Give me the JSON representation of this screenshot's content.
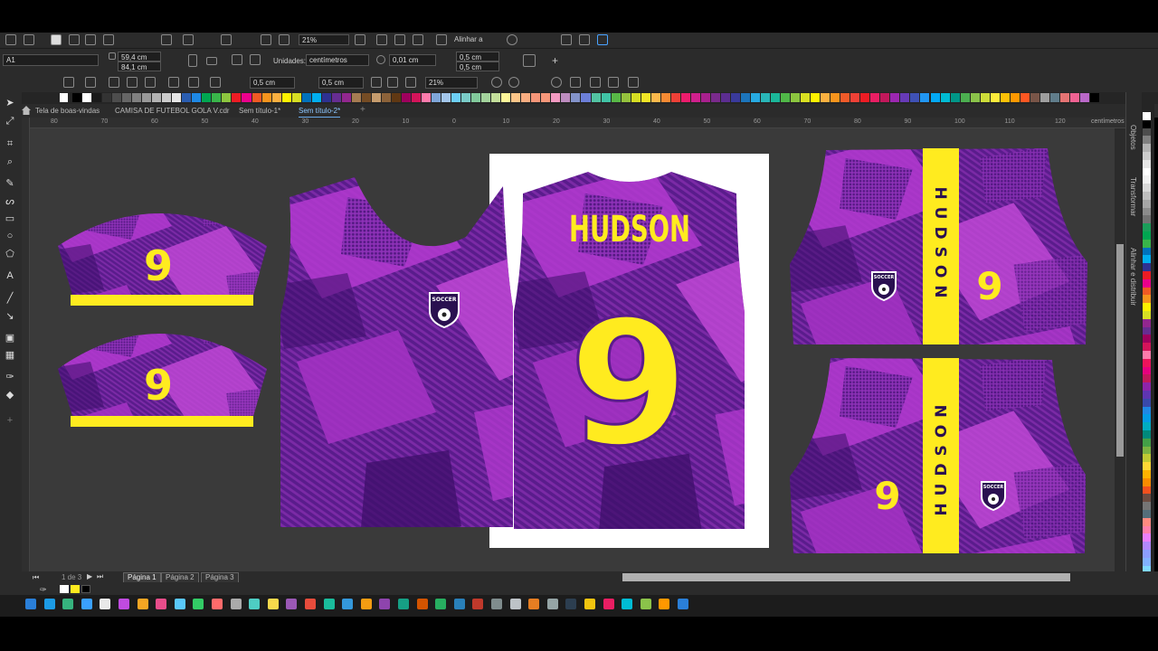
{
  "toolbar": {
    "zoom": "21%",
    "align_label": "Alinhar a",
    "object_name": "A1",
    "width": "59,4 cm",
    "height": "84,1 cm",
    "units_label": "Unidades:",
    "units_value": "centímetros",
    "nudge": "0,01 cm",
    "dup_x": "0,5 cm",
    "dup_y": "0,5 cm"
  },
  "toolbar3": {
    "outline_w": "0,5 cm",
    "outline_h": "0,5 cm",
    "zoom": "21%"
  },
  "tabs": [
    {
      "label": "Tela de boas-vindas"
    },
    {
      "label": "CAMISA DE FUTEBOL GOLA V.cdr"
    },
    {
      "label": "Sem título-1*"
    },
    {
      "label": "Sem título-2*"
    }
  ],
  "ruler": {
    "ticks": [
      "80",
      "70",
      "60",
      "50",
      "40",
      "30",
      "20",
      "10",
      "0",
      "10",
      "20",
      "30",
      "40",
      "50",
      "60",
      "70",
      "80",
      "90",
      "100",
      "110",
      "120"
    ],
    "unit": "centímetros"
  },
  "docker": {
    "tabs": [
      "Objetos",
      "Transformar",
      "Alinhar e distribuir"
    ]
  },
  "jersey": {
    "name": "HUDSON",
    "number": "9",
    "badge_text": "SOCCER",
    "colors": {
      "purple": "#5a1c8c",
      "magenta": "#b43ad0",
      "yellow": "#ffeb1f",
      "white": "#ffffff"
    }
  },
  "pages": {
    "counter": "1 de 3",
    "items": [
      "Página 1",
      "Página 2",
      "Página 3"
    ]
  },
  "palette": [
    "#000000",
    "#ffffff",
    "#1a1a1a",
    "#333333",
    "#4d4d4d",
    "#666666",
    "#808080",
    "#999999",
    "#b3b3b3",
    "#cccccc",
    "#e6e6e6",
    "#2a5db0",
    "#1e88e5",
    "#00a651",
    "#39b54a",
    "#8dc63f",
    "#ed1c24",
    "#ec008c",
    "#f15a24",
    "#f7941d",
    "#fbb040",
    "#fff200",
    "#d7df23",
    "#0072bc",
    "#00aeef",
    "#2e3192",
    "#662d91",
    "#92278f",
    "#a67c52",
    "#754c24",
    "#c69c6d",
    "#8c6239",
    "#603813",
    "#9e005d",
    "#d4145a",
    "#ff7bac",
    "#7fa6d9",
    "#a3c7ec",
    "#6dcff6",
    "#7accc8",
    "#82ca9c",
    "#a3d39c",
    "#c4df9b",
    "#fff799",
    "#fdc689",
    "#f9ad81",
    "#f69679",
    "#f7977a",
    "#f49ac2",
    "#bd8cbf",
    "#8393ca",
    "#6c7fd8",
    "#52c3a2",
    "#40c4a6",
    "#58b947",
    "#95c23d",
    "#d6de23",
    "#f2e526",
    "#fcb94c",
    "#f68a33",
    "#ee4037",
    "#ec1c6c",
    "#d0208d",
    "#a9208e",
    "#7a2a8c",
    "#5c2d91",
    "#3a3a9c",
    "#1c75bc",
    "#27aae1",
    "#29b6b8",
    "#1bb79a",
    "#50b848",
    "#8cc63f",
    "#d9e021",
    "#fff200",
    "#fbb040",
    "#f7941d",
    "#f15a29",
    "#ef4136",
    "#ed1c24",
    "#e91e63",
    "#c2185b",
    "#9c27b0",
    "#673ab7",
    "#3f51b5",
    "#2196f3",
    "#03a9f4",
    "#00bcd4",
    "#009688",
    "#4caf50",
    "#8bc34a",
    "#cddc39",
    "#ffeb3b",
    "#ffc107",
    "#ff9800",
    "#ff5722",
    "#795548",
    "#9e9e9e",
    "#607d8b",
    "#e57373",
    "#f06292",
    "#ba68c8",
    "#000000"
  ],
  "vpalette": [
    "#ffffff",
    "#000000",
    "#4d4d4d",
    "#808080",
    "#b3b3b3",
    "#cccccc",
    "#e6e6e6",
    "#ffffff",
    "#f2f2f2",
    "#d9d9d9",
    "#bfbfbf",
    "#a6a6a6",
    "#8c8c8c",
    "#737373",
    "#1b9e5a",
    "#00a651",
    "#39b54a",
    "#0072bc",
    "#00aeef",
    "#2e3192",
    "#ed1c24",
    "#ec008c",
    "#f15a24",
    "#f7941d",
    "#fff200",
    "#d7df23",
    "#92278f",
    "#662d91",
    "#9e005d",
    "#d4145a",
    "#ff7bac",
    "#ed145b",
    "#e6007e",
    "#c2185b",
    "#8e24aa",
    "#5e35b1",
    "#3949ab",
    "#1e88e5",
    "#039be5",
    "#00acc1",
    "#00897b",
    "#43a047",
    "#7cb342",
    "#c0ca33",
    "#fdd835",
    "#ffb300",
    "#fb8c00",
    "#f4511e",
    "#6d4c41",
    "#757575",
    "#546e7a",
    "#ff8a80",
    "#ff80ab",
    "#ea80fc",
    "#b388ff",
    "#8c9eff",
    "#82b1ff",
    "#80d8ff",
    "#84ffff",
    "#a7ffeb"
  ]
}
